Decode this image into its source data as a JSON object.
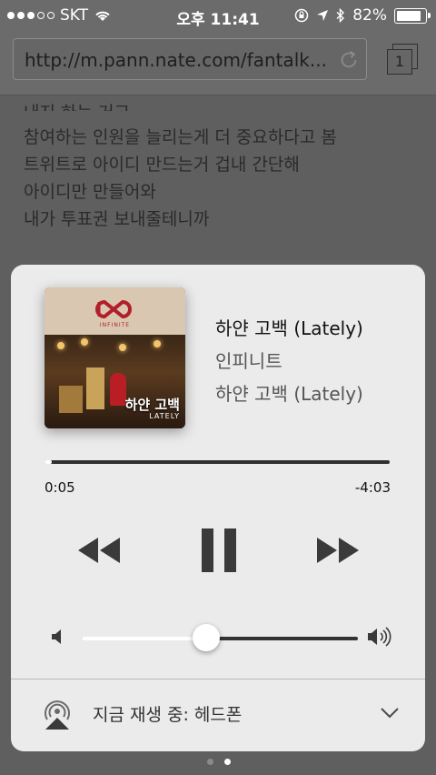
{
  "status_bar": {
    "carrier": "SKT",
    "time": "오후 11:41",
    "battery": "82%",
    "icons": [
      "signal-dots",
      "wifi-icon",
      "rotation-lock-icon",
      "location-icon",
      "bluetooth-icon",
      "battery-icon"
    ]
  },
  "browser": {
    "url": "http://m.pann.nate.com/fantalk...",
    "tab_count": "1",
    "content_lines": [
      "내지 하는 거고",
      "참여하는 인원을 늘리는게 더 중요하다고 봄",
      "트위트로 아이디 만드는거 겁내 간단해",
      "아이디만 만들어와",
      "내가 투표권 보내줄테니까"
    ]
  },
  "now_playing": {
    "song": "하얀 고백 (Lately)",
    "artist": "인피니트",
    "album": "하얀 고백 (Lately)",
    "art_title": "하얀 고백",
    "art_subtitle": "LATELY",
    "art_logo_text": "INFINITE",
    "elapsed": "0:05",
    "remaining": "-4:03",
    "progress": 0.02,
    "volume": 0.45
  },
  "output": {
    "label": "지금 재생 중: 헤드폰"
  },
  "colors": {
    "card_bg": "#ebebeb",
    "dim_bg": "#5f5f5f",
    "logo_red": "#b21e2a"
  }
}
